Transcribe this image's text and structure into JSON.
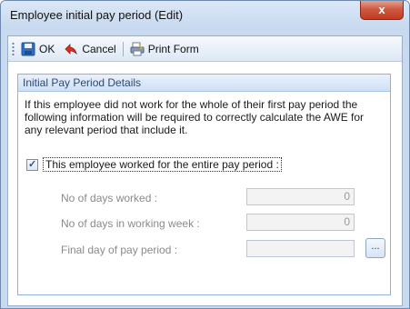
{
  "window": {
    "title": "Employee initial pay period (Edit)",
    "close_label": "x"
  },
  "toolbar": {
    "ok_label": "OK",
    "cancel_label": "Cancel",
    "print_label": "Print Form"
  },
  "group": {
    "header": "Initial Pay Period Details",
    "info_text": "If this employee did not work for the whole of their first pay period the following information will be required to correctly calculate the AWE for any relevant period that include it.",
    "checkbox_label": "This employee worked for the entire pay period :",
    "checkbox_checked": true,
    "fields": {
      "days_worked_label": "No of days worked :",
      "days_worked_value": "0",
      "days_week_label": "No of days in working week :",
      "days_week_value": "0",
      "final_day_label": "Final day of pay period :",
      "final_day_value": "",
      "browse_label": "..."
    }
  },
  "colors": {
    "accent": "#2d4a73",
    "close": "#c0391f",
    "disabled_text": "#8a8a8a"
  }
}
